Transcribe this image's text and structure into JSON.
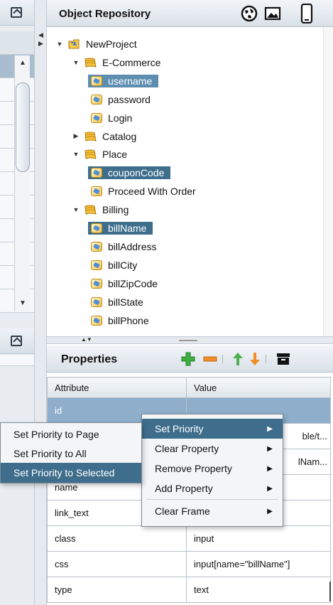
{
  "repo": {
    "title": "Object Repository",
    "tree": [
      {
        "label": "NewProject",
        "type": "project",
        "expanded": true,
        "level": 0
      },
      {
        "label": "E-Commerce",
        "type": "page",
        "expanded": true,
        "level": 1
      },
      {
        "label": "username",
        "type": "object",
        "level": 2,
        "state": "selected-light"
      },
      {
        "label": "password",
        "type": "object",
        "level": 2
      },
      {
        "label": "Login",
        "type": "object",
        "level": 2
      },
      {
        "label": "Catalog",
        "type": "page",
        "expanded": false,
        "level": 1
      },
      {
        "label": "Place",
        "type": "page",
        "expanded": true,
        "level": 1
      },
      {
        "label": "couponCode",
        "type": "object",
        "level": 2,
        "state": "selected"
      },
      {
        "label": "Proceed With Order",
        "type": "object",
        "level": 2
      },
      {
        "label": "Billing",
        "type": "page",
        "expanded": true,
        "level": 1
      },
      {
        "label": "billName",
        "type": "object",
        "level": 2,
        "state": "selected"
      },
      {
        "label": "billAddress",
        "type": "object",
        "level": 2
      },
      {
        "label": "billCity",
        "type": "object",
        "level": 2
      },
      {
        "label": "billZipCode",
        "type": "object",
        "level": 2
      },
      {
        "label": "billState",
        "type": "object",
        "level": 2
      },
      {
        "label": "billPhone",
        "type": "object",
        "level": 2
      }
    ]
  },
  "properties": {
    "title": "Properties",
    "columns": [
      "Attribute",
      "Value"
    ],
    "rows": [
      {
        "attr": "id",
        "value": "",
        "selected": true
      },
      {
        "attr": "",
        "value": "ble/t..."
      },
      {
        "attr": "",
        "value": "lNam..."
      },
      {
        "attr": "name",
        "value": ""
      },
      {
        "attr": "link_text",
        "value": ""
      },
      {
        "attr": "class",
        "value": "input"
      },
      {
        "attr": "css",
        "value": "input[name=\"billName\"]"
      },
      {
        "attr": "type",
        "value": "text"
      }
    ]
  },
  "context_menu": {
    "items": [
      {
        "label": "Set Priority",
        "highlighted": true
      },
      {
        "label": "Clear Property"
      },
      {
        "label": "Remove Property"
      },
      {
        "label": "Add Property"
      },
      {
        "label": "Clear Frame"
      }
    ]
  },
  "submenu": {
    "items": [
      {
        "label": "Set Priority to Page"
      },
      {
        "label": "Set Priority to All"
      },
      {
        "label": "Set Priority to Selected",
        "highlighted": true
      }
    ]
  },
  "colors": {
    "selection": "#3e6e8c",
    "header": "#d9e1e8",
    "add": "#3cb043",
    "remove": "#f28c28",
    "up": "#4caf50",
    "down": "#f28c28"
  }
}
